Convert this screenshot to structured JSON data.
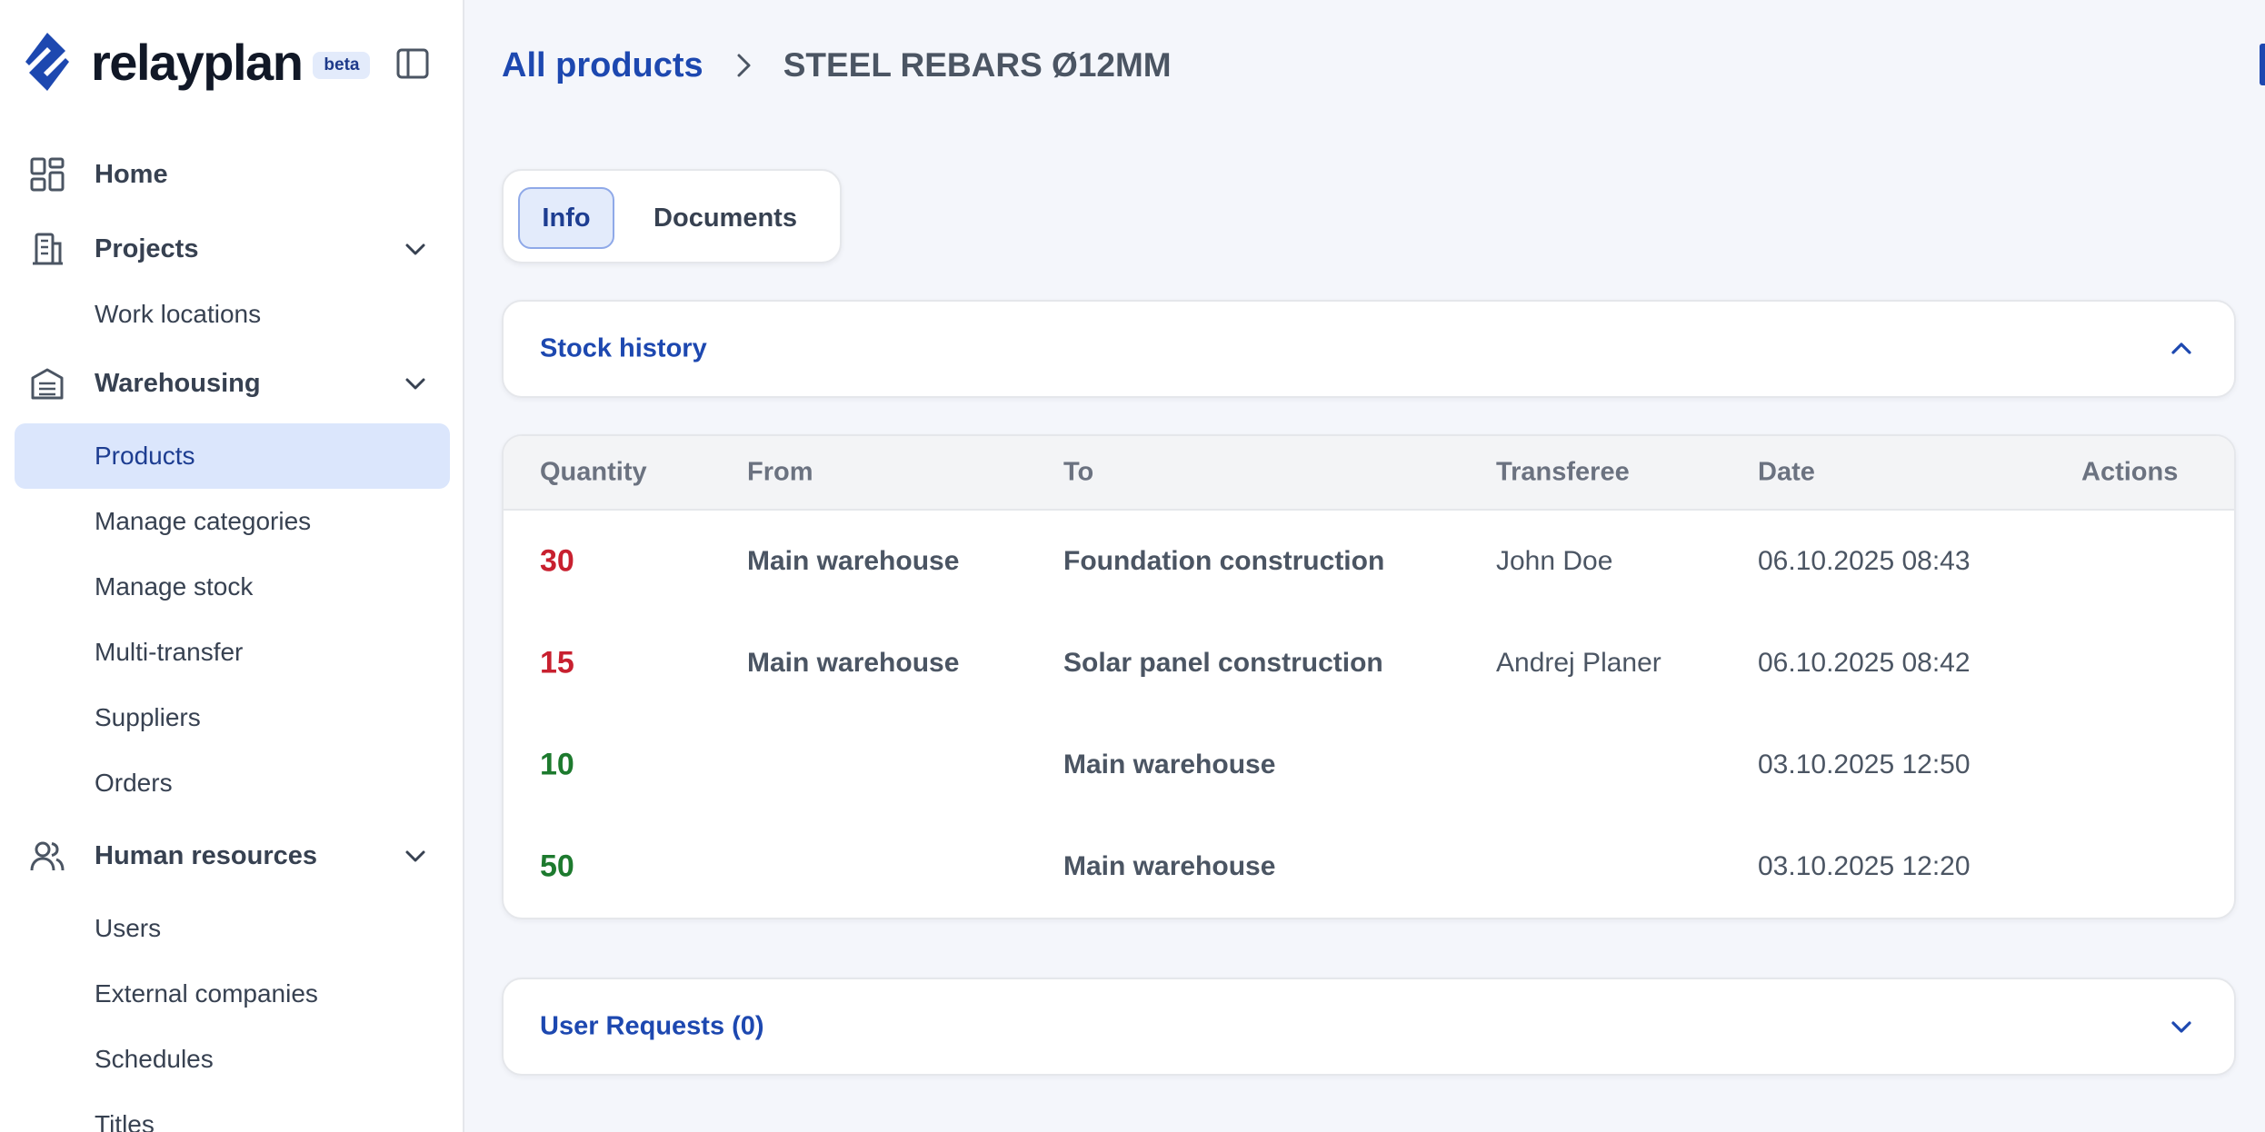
{
  "brand": {
    "name": "relayplan",
    "badge": "beta"
  },
  "sidebar": {
    "groups": [
      {
        "label": "Home",
        "icon": "dashboard-icon",
        "expandable": false,
        "items": []
      },
      {
        "label": "Projects",
        "icon": "building-icon",
        "expandable": true,
        "items": [
          {
            "label": "Work locations"
          }
        ]
      },
      {
        "label": "Warehousing",
        "icon": "warehouse-icon",
        "expandable": true,
        "items": [
          {
            "label": "Products",
            "active": true
          },
          {
            "label": "Manage categories"
          },
          {
            "label": "Manage stock"
          },
          {
            "label": "Multi-transfer"
          },
          {
            "label": "Suppliers"
          },
          {
            "label": "Orders"
          }
        ]
      },
      {
        "label": "Human resources",
        "icon": "users-icon",
        "expandable": true,
        "items": [
          {
            "label": "Users"
          },
          {
            "label": "External companies"
          },
          {
            "label": "Schedules"
          },
          {
            "label": "Titles"
          }
        ]
      }
    ]
  },
  "breadcrumb": {
    "parent": "All products",
    "current": "STEEL REBARS Ø12MM"
  },
  "tabs": {
    "info": "Info",
    "documents": "Documents",
    "active": "Info"
  },
  "stock_history": {
    "title": "Stock history",
    "expanded": true,
    "columns": {
      "quantity": "Quantity",
      "from": "From",
      "to": "To",
      "transferee": "Transferee",
      "date": "Date",
      "actions": "Actions"
    },
    "rows": [
      {
        "quantity": "30",
        "direction": "out",
        "from": "Main warehouse",
        "to": "Foundation construction",
        "transferee": "John Doe",
        "date": "06.10.2025 08:43"
      },
      {
        "quantity": "15",
        "direction": "out",
        "from": "Main warehouse",
        "to": "Solar panel construction",
        "transferee": "Andrej Planer",
        "date": "06.10.2025 08:42"
      },
      {
        "quantity": "10",
        "direction": "in",
        "from": "",
        "to": "Main warehouse",
        "transferee": "",
        "date": "03.10.2025 12:50"
      },
      {
        "quantity": "50",
        "direction": "in",
        "from": "",
        "to": "Main warehouse",
        "transferee": "",
        "date": "03.10.2025 12:20"
      }
    ]
  },
  "user_requests": {
    "title": "User Requests (0)",
    "expanded": false
  },
  "colors": {
    "accent": "#1d48b0",
    "out": "#c8202f",
    "in": "#1d7a2e",
    "active_bg": "#dbe6fc"
  }
}
